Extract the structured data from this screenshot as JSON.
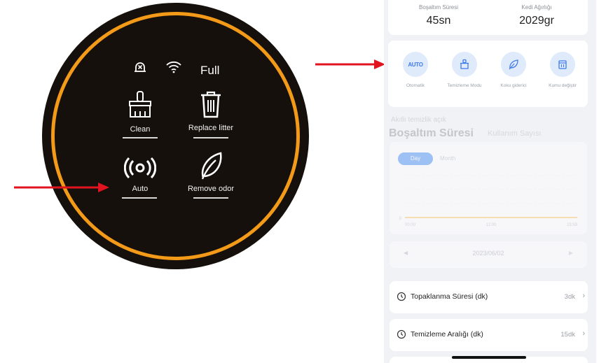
{
  "colors": {
    "ring": "#f39a18",
    "device_bg": "#15100c",
    "arrow": "#e0131f",
    "mode_bg": "#dfeafb",
    "mode_icon": "#3f7be8",
    "day_button": "#3a86f5",
    "chart_line": "#f5b52b"
  },
  "device": {
    "status": {
      "alarm_icon": "alarm-x-icon",
      "wifi_icon": "wifi-icon",
      "level_text": "Full"
    },
    "buttons": [
      {
        "icon": "broom-icon",
        "label": "Clean"
      },
      {
        "icon": "trash-icon",
        "label": "Replace litter"
      },
      {
        "icon": "signal-icon",
        "label": "Auto"
      },
      {
        "icon": "leaf-icon",
        "label": "Remove odor"
      }
    ]
  },
  "phone": {
    "stats": [
      {
        "label": "Boşaltım Süresi",
        "value": "45sn"
      },
      {
        "label": "Kedi Ağırlığı",
        "value": "2029gr"
      }
    ],
    "modes": [
      {
        "icon": "auto-icon",
        "icon_text": "AUTO",
        "label": "Otomatik"
      },
      {
        "icon": "basket-icon",
        "label": "Temizleme Modu"
      },
      {
        "icon": "leaf-icon",
        "label": "Koku giderici"
      },
      {
        "icon": "bin-icon",
        "label": "Kumu değiştir"
      }
    ],
    "smart_clean_text": "Akıllı temizlik açık",
    "tabs": [
      "Boşaltım Süresi",
      "Kullanım Sayısı"
    ],
    "period_buttons": [
      "Day",
      "Month"
    ],
    "chart_data": {
      "type": "line",
      "y_ticks": [
        "0"
      ],
      "x_ticks": [
        "00:00",
        "12:00",
        "23:59"
      ],
      "series": [
        {
          "values": [
            0,
            0
          ]
        }
      ],
      "ylim": [
        0,
        1
      ]
    },
    "date": "2023/06/02",
    "settings": [
      {
        "icon": "clock-icon",
        "label": "Topaklanma Süresi (dk)",
        "value": "3dk"
      },
      {
        "icon": "clock-icon",
        "label": "Temizleme Aralığı (dk)",
        "value": "15dk"
      }
    ]
  }
}
